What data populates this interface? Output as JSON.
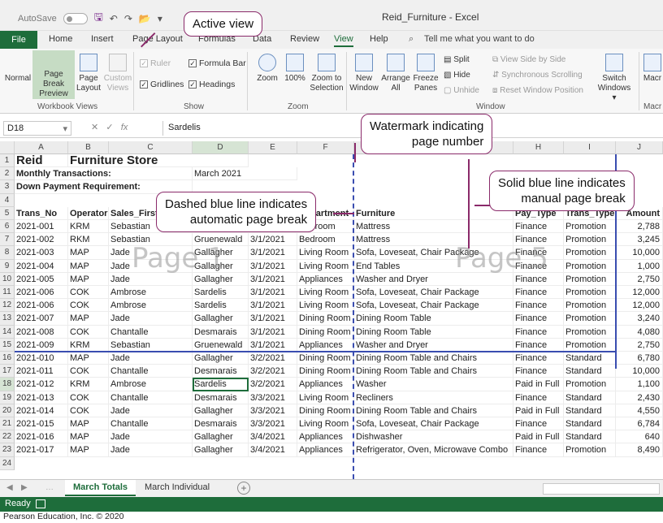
{
  "titlebar": {
    "autosave_label": "AutoSave",
    "toggle_state": "Off",
    "window_title": "Reid_Furniture - Excel"
  },
  "ribbon": {
    "file_tab": "File",
    "tabs": [
      "Home",
      "Insert",
      "Page Layout",
      "Formulas",
      "Data",
      "Review",
      "View",
      "Help"
    ],
    "active_tab": "View",
    "tell_me": "Tell me what you want to do",
    "workbook_views": {
      "normal": "Normal",
      "page_break_preview_1": "Page Break",
      "page_break_preview_2": "Preview",
      "page_layout_1": "Page",
      "page_layout_2": "Layout",
      "custom_views_1": "Custom",
      "custom_views_2": "Views",
      "group_label": "Workbook Views"
    },
    "show": {
      "ruler": "Ruler",
      "formula_bar": "Formula Bar",
      "gridlines": "Gridlines",
      "headings": "Headings",
      "group_label": "Show"
    },
    "zoom": {
      "zoom": "Zoom",
      "hundred": "100%",
      "zoom_to_selection_1": "Zoom to",
      "zoom_to_selection_2": "Selection",
      "group_label": "Zoom"
    },
    "window": {
      "new_window_1": "New",
      "new_window_2": "Window",
      "arrange_all_1": "Arrange",
      "arrange_all_2": "All",
      "freeze_panes_1": "Freeze",
      "freeze_panes_2": "Panes",
      "split": "Split",
      "hide": "Hide",
      "unhide": "Unhide",
      "view_side_by_side": "View Side by Side",
      "synchronous_scrolling": "Synchronous Scrolling",
      "reset_window_position": "Reset Window Position",
      "switch_windows_1": "Switch",
      "switch_windows_2": "Windows",
      "group_label": "Window"
    },
    "macros": {
      "label": "Macr",
      "group_label": "Macr"
    }
  },
  "formula_bar": {
    "name_box": "D18",
    "fx": "fx",
    "value": "Sardelis"
  },
  "sheet": {
    "columns": [
      "A",
      "B",
      "C",
      "D",
      "E",
      "F",
      "G",
      "H",
      "I",
      "J"
    ],
    "title_a": "Reid",
    "title_b": "Furniture Store",
    "monthly_label": "Monthly Transactions:",
    "monthly_value": "March 2021",
    "down_payment_label": "Down Payment Requirement:",
    "headers": [
      "Trans_No",
      "Operator",
      "Sales_First",
      "Sales_Last",
      "Date",
      "Department",
      "Furniture",
      "Pay_Type",
      "Trans_Type",
      "Amount"
    ],
    "rows": [
      [
        "2021-001",
        "KRM",
        "Sebastian",
        "Gruenewald",
        "3/1/2021",
        "Bedroom",
        "Mattress",
        "Finance",
        "Promotion",
        "2,788"
      ],
      [
        "2021-002",
        "RKM",
        "Sebastian",
        "Gruenewald",
        "3/1/2021",
        "Bedroom",
        "Mattress",
        "Finance",
        "Promotion",
        "3,245"
      ],
      [
        "2021-003",
        "MAP",
        "Jade",
        "Gallagher",
        "3/1/2021",
        "Living Room",
        "Sofa, Loveseat, Chair Package",
        "Finance",
        "Promotion",
        "10,000"
      ],
      [
        "2021-004",
        "MAP",
        "Jade",
        "Gallagher",
        "3/1/2021",
        "Living Room",
        "End Tables",
        "Finance",
        "Promotion",
        "1,000"
      ],
      [
        "2021-005",
        "MAP",
        "Jade",
        "Gallagher",
        "3/1/2021",
        "Appliances",
        "Washer and Dryer",
        "Finance",
        "Promotion",
        "2,750"
      ],
      [
        "2021-006",
        "COK",
        "Ambrose",
        "Sardelis",
        "3/1/2021",
        "Living Room",
        "Sofa, Loveseat, Chair Package",
        "Finance",
        "Promotion",
        "12,000"
      ],
      [
        "2021-006",
        "COK",
        "Ambrose",
        "Sardelis",
        "3/1/2021",
        "Living Room",
        "Sofa, Loveseat, Chair Package",
        "Finance",
        "Promotion",
        "12,000"
      ],
      [
        "2021-007",
        "MAP",
        "Jade",
        "Gallagher",
        "3/1/2021",
        "Dining Room",
        "Dining Room Table",
        "Finance",
        "Promotion",
        "3,240"
      ],
      [
        "2021-008",
        "COK",
        "Chantalle",
        "Desmarais",
        "3/1/2021",
        "Dining Room",
        "Dining Room Table",
        "Finance",
        "Promotion",
        "4,080"
      ],
      [
        "2021-009",
        "KRM",
        "Sebastian",
        "Gruenewald",
        "3/1/2021",
        "Appliances",
        "Washer and Dryer",
        "Finance",
        "Promotion",
        "2,750"
      ],
      [
        "2021-010",
        "MAP",
        "Jade",
        "Gallagher",
        "3/2/2021",
        "Dining Room",
        "Dining Room Table and Chairs",
        "Finance",
        "Standard",
        "6,780"
      ],
      [
        "2021-011",
        "COK",
        "Chantalle",
        "Desmarais",
        "3/2/2021",
        "Dining Room",
        "Dining Room Table and Chairs",
        "Finance",
        "Standard",
        "10,000"
      ],
      [
        "2021-012",
        "KRM",
        "Ambrose",
        "Sardelis",
        "3/2/2021",
        "Appliances",
        "Washer",
        "Paid in Full",
        "Promotion",
        "1,100"
      ],
      [
        "2021-013",
        "COK",
        "Chantalle",
        "Desmarais",
        "3/3/2021",
        "Living Room",
        "Recliners",
        "Finance",
        "Standard",
        "2,430"
      ],
      [
        "2021-014",
        "COK",
        "Jade",
        "Gallagher",
        "3/3/2021",
        "Dining Room",
        "Dining Room Table and Chairs",
        "Paid in Full",
        "Standard",
        "4,550"
      ],
      [
        "2021-015",
        "MAP",
        "Chantalle",
        "Desmarais",
        "3/3/2021",
        "Living Room",
        "Sofa, Loveseat, Chair Package",
        "Finance",
        "Standard",
        "6,784"
      ],
      [
        "2021-016",
        "MAP",
        "Jade",
        "Gallagher",
        "3/4/2021",
        "Appliances",
        "Dishwasher",
        "Paid in Full",
        "Standard",
        "640"
      ],
      [
        "2021-017",
        "MAP",
        "Jade",
        "Gallagher",
        "3/4/2021",
        "Appliances",
        "Refrigerator, Oven, Microwave Combo",
        "Finance",
        "Promotion",
        "8,490"
      ]
    ],
    "watermark_1": "Page 1",
    "watermark_5": "Page 5"
  },
  "sheet_tabs": {
    "tabs": [
      "March Totals",
      "March Individual"
    ],
    "active": "March Totals",
    "add": "+"
  },
  "status": {
    "ready": "Ready"
  },
  "credit": "Pearson Education, Inc. © 2020",
  "callouts": {
    "active_view": "Active view",
    "watermark_1": "Watermark indicating",
    "watermark_2": "page number",
    "solid_1": "Solid blue line indicates",
    "solid_2": "manual page break",
    "dashed_1": "Dashed blue line indicates",
    "dashed_2": "automatic page break"
  },
  "colors": {
    "excel_green": "#1e6d3b",
    "page_break_blue": "#3a4db0",
    "callout_border": "#8a2a6a"
  }
}
